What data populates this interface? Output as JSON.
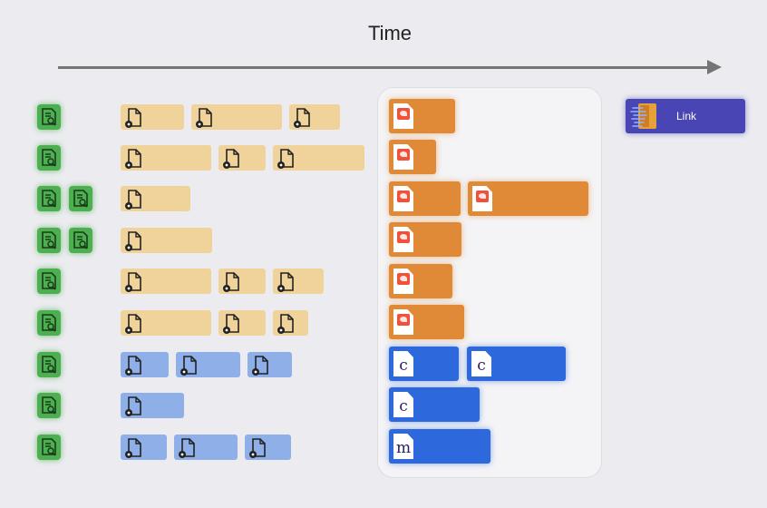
{
  "header": {
    "title": "Time"
  },
  "link": {
    "label": "Link"
  },
  "compile_blocks": [
    {
      "color": "orange",
      "kind": "swift"
    },
    {
      "color": "orange",
      "kind": "swift"
    },
    {
      "color": "orange",
      "kind": "swift"
    },
    {
      "color": "orange",
      "kind": "swift"
    },
    {
      "color": "orange",
      "kind": "swift"
    },
    {
      "color": "orange",
      "kind": "swift"
    },
    {
      "color": "orange",
      "kind": "swift"
    },
    {
      "color": "blue",
      "kind": "c",
      "letter": "c"
    },
    {
      "color": "blue",
      "kind": "c",
      "letter": "c"
    },
    {
      "color": "blue",
      "kind": "c",
      "letter": "c"
    },
    {
      "color": "blue",
      "kind": "m",
      "letter": "m"
    }
  ],
  "colors": {
    "green_icon": "#4caf50",
    "yellow_task": "#f0d39a",
    "light_blue_task": "#8eafe7",
    "orange_compile": "#e08a37",
    "blue_compile": "#2d68dc",
    "link": "#4a45b5"
  },
  "icons": [
    "document-search-icon",
    "file-gear-icon",
    "swift-file-icon",
    "c-file-icon",
    "m-file-icon",
    "link-icon"
  ]
}
